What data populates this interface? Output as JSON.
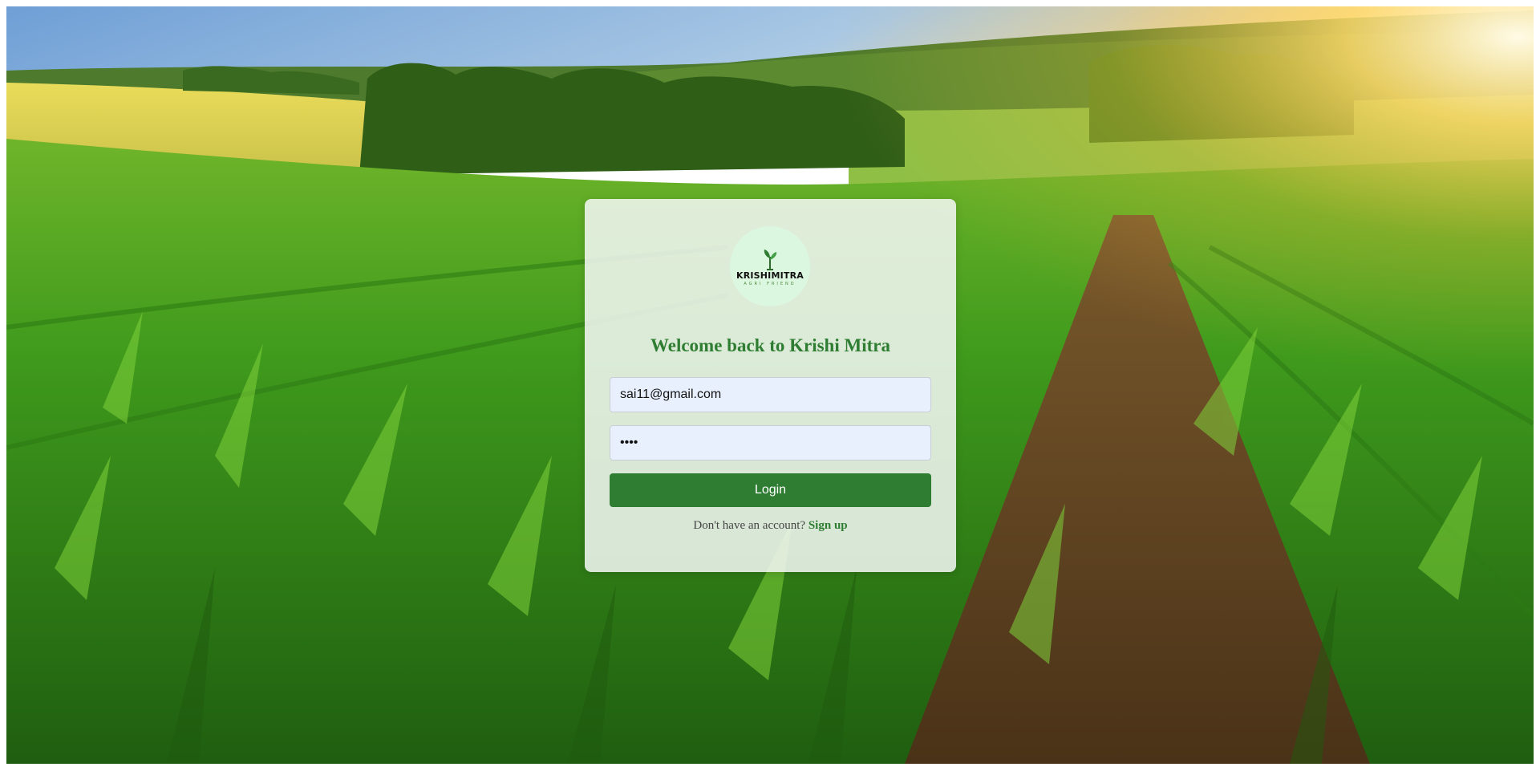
{
  "background": {
    "description_icon": "cornfield-background"
  },
  "login_card": {
    "logo": {
      "brand": "KRISHIMITRA",
      "tagline": "AGRI FRIEND"
    },
    "heading": "Welcome back to Krishi Mitra",
    "email_field": {
      "value": "sai11@gmail.com"
    },
    "password_field": {
      "value": "••••"
    },
    "login_button": "Login",
    "signup_prompt": "Don't have an account?",
    "signup_link": "Sign up"
  },
  "colors": {
    "brand_green": "#2e7d32",
    "input_bg": "#e8f0fe",
    "logo_bg": "#dcf7e0"
  }
}
